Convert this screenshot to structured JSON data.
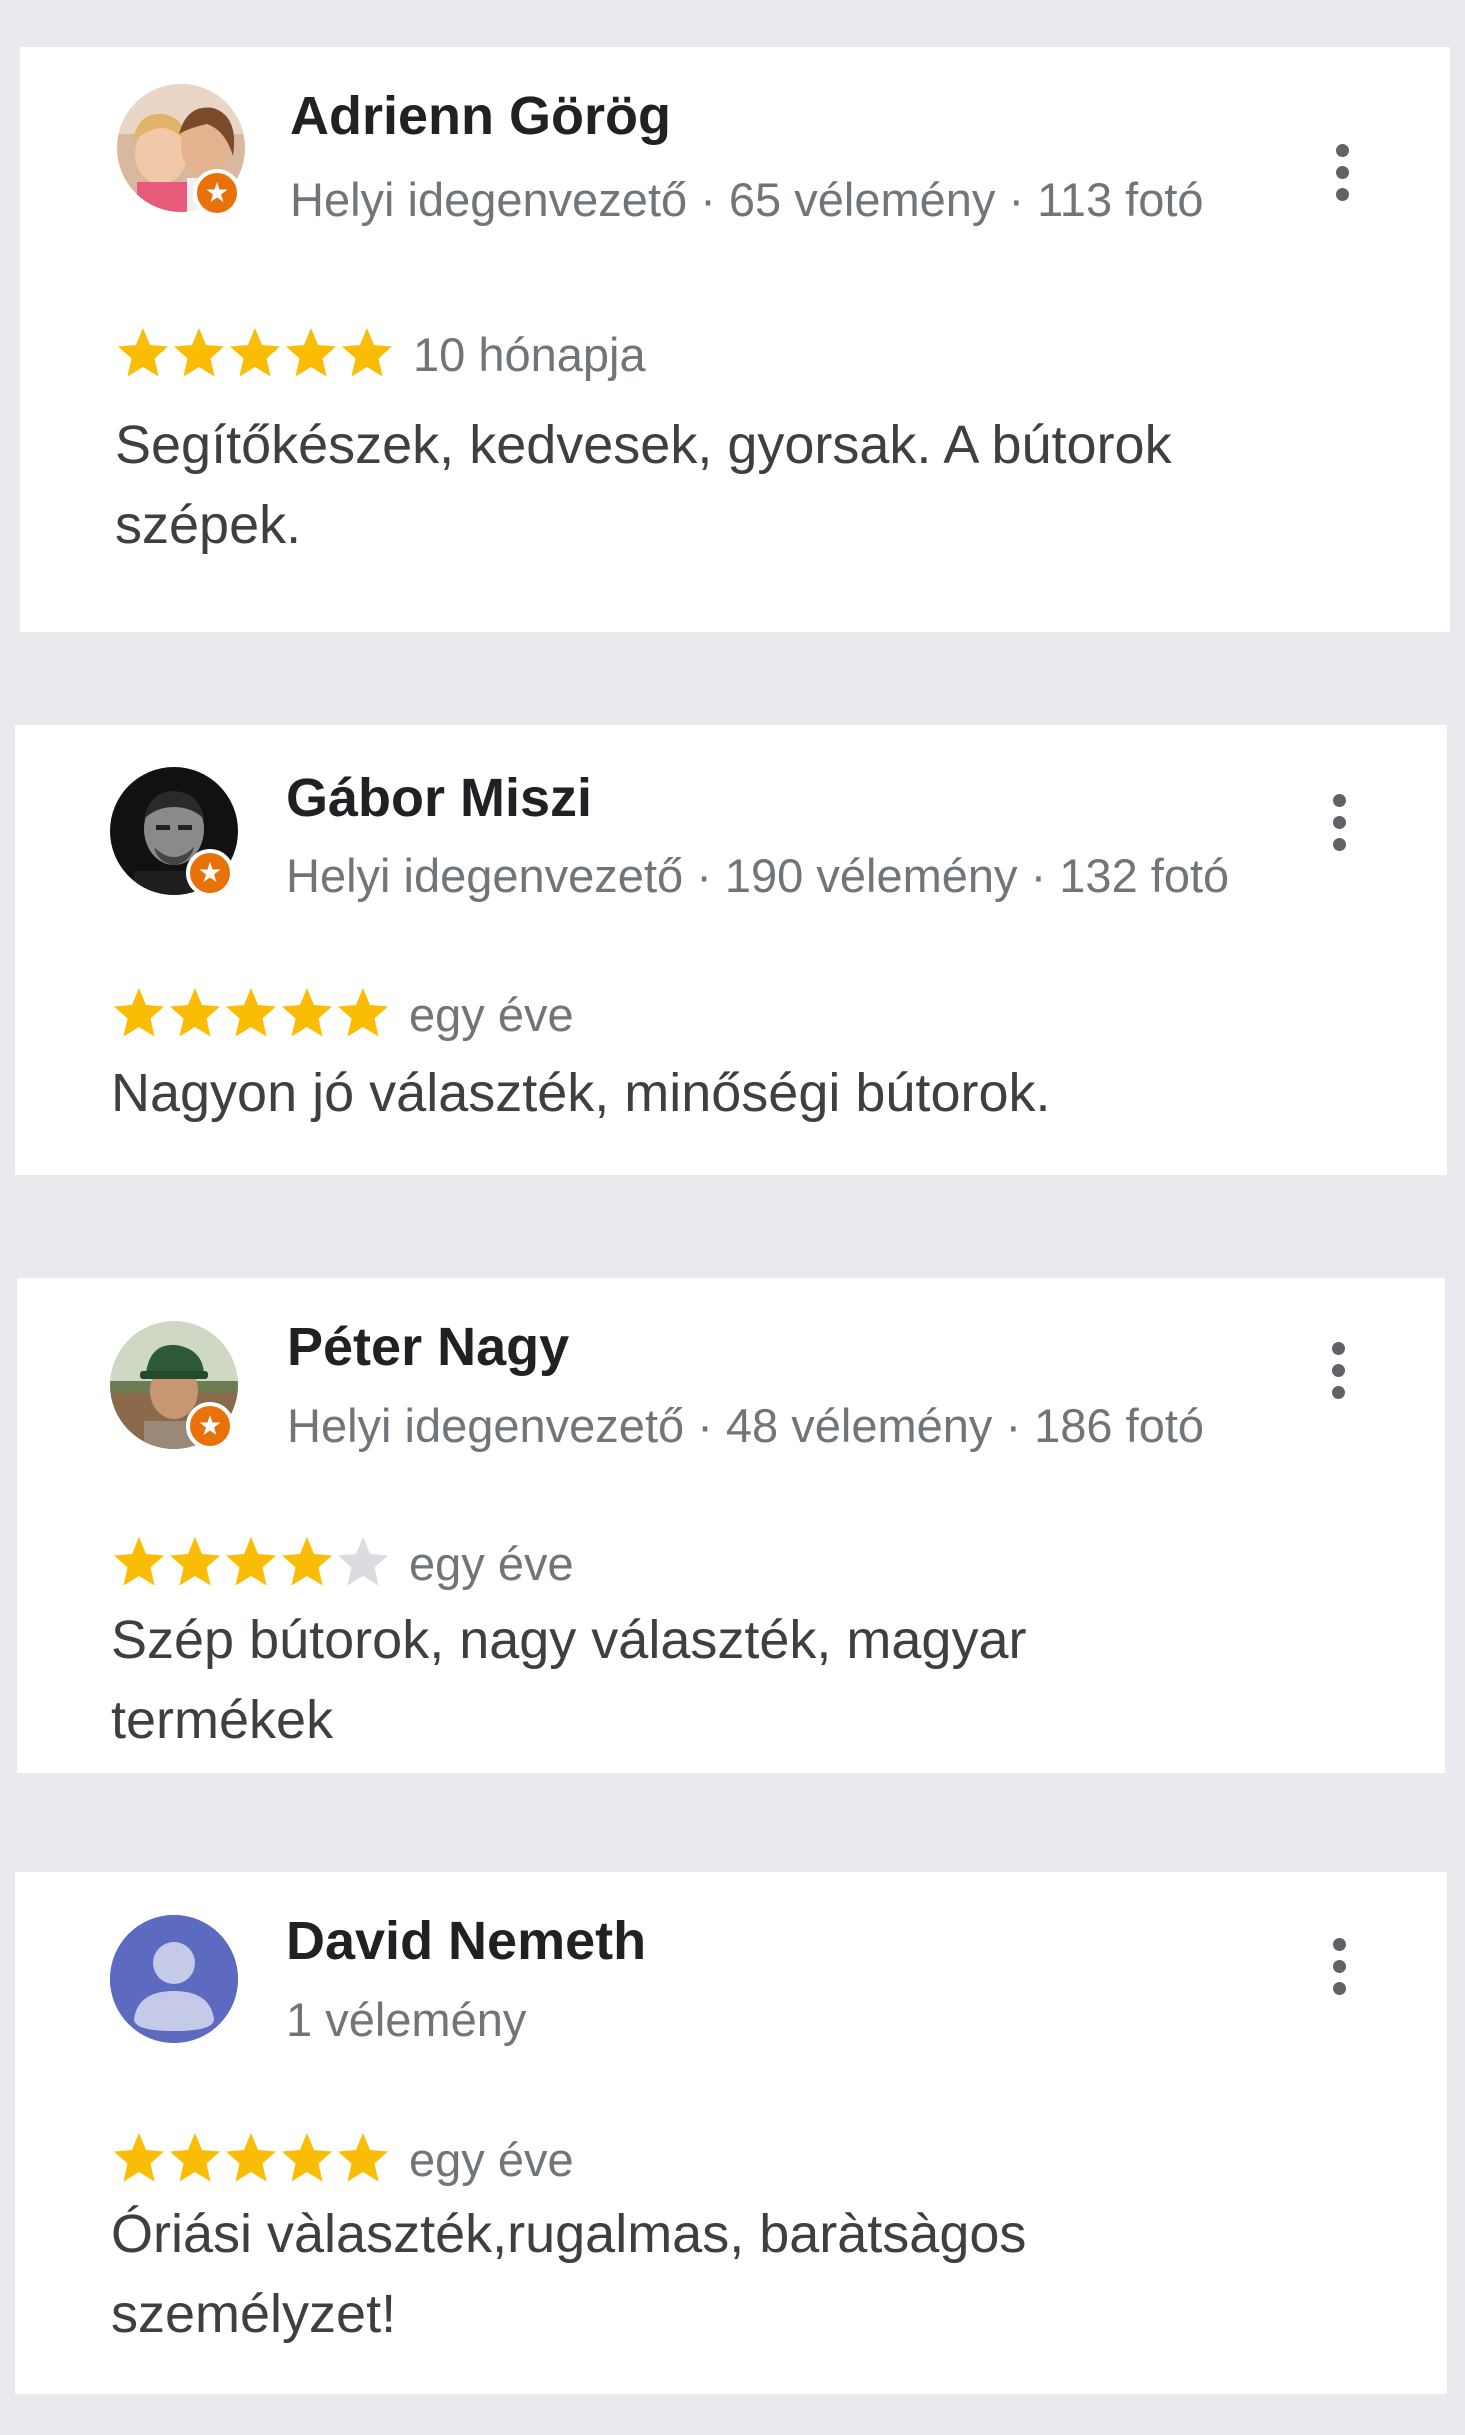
{
  "reviews": [
    {
      "name": "Adrienn Görög",
      "meta": "Helyi idegenvezető · 65 vélemény · 113 fotó",
      "rating": 5,
      "date": "10 hónapja",
      "text": "Segítőkészek, kedvesek, gyorsak. A bútorok szépek.",
      "local_guide": true,
      "avatar": "photo-avatar"
    },
    {
      "name": "Gábor Miszi",
      "meta": "Helyi idegenvezető · 190 vélemény · 132 fotó",
      "rating": 5,
      "date": "egy éve",
      "text": "Nagyon jó választék, minőségi bútorok.",
      "local_guide": true,
      "avatar": "photo-avatar"
    },
    {
      "name": "Péter Nagy",
      "meta": "Helyi idegenvezető · 48 vélemény · 186 fotó",
      "rating": 4,
      "date": "egy éve",
      "text": "Szép bútorok, nagy választék, magyar termékek",
      "local_guide": true,
      "avatar": "photo-avatar"
    },
    {
      "name": "David Nemeth",
      "meta": "1 vélemény",
      "rating": 5,
      "date": "egy éve",
      "text": "Óriási vàlaszték,rugalmas, baràtsàgos személyzet!",
      "local_guide": false,
      "avatar": "default-person-avatar"
    }
  ],
  "colors": {
    "star_filled": "#fbbc04",
    "star_empty": "#dadce0",
    "local_guide_badge": "#e8710a",
    "default_avatar_bg": "#5c6bc0"
  },
  "icons": {
    "more": "more-vert-icon",
    "star": "star-icon",
    "badge": "local-guide-badge-icon"
  }
}
